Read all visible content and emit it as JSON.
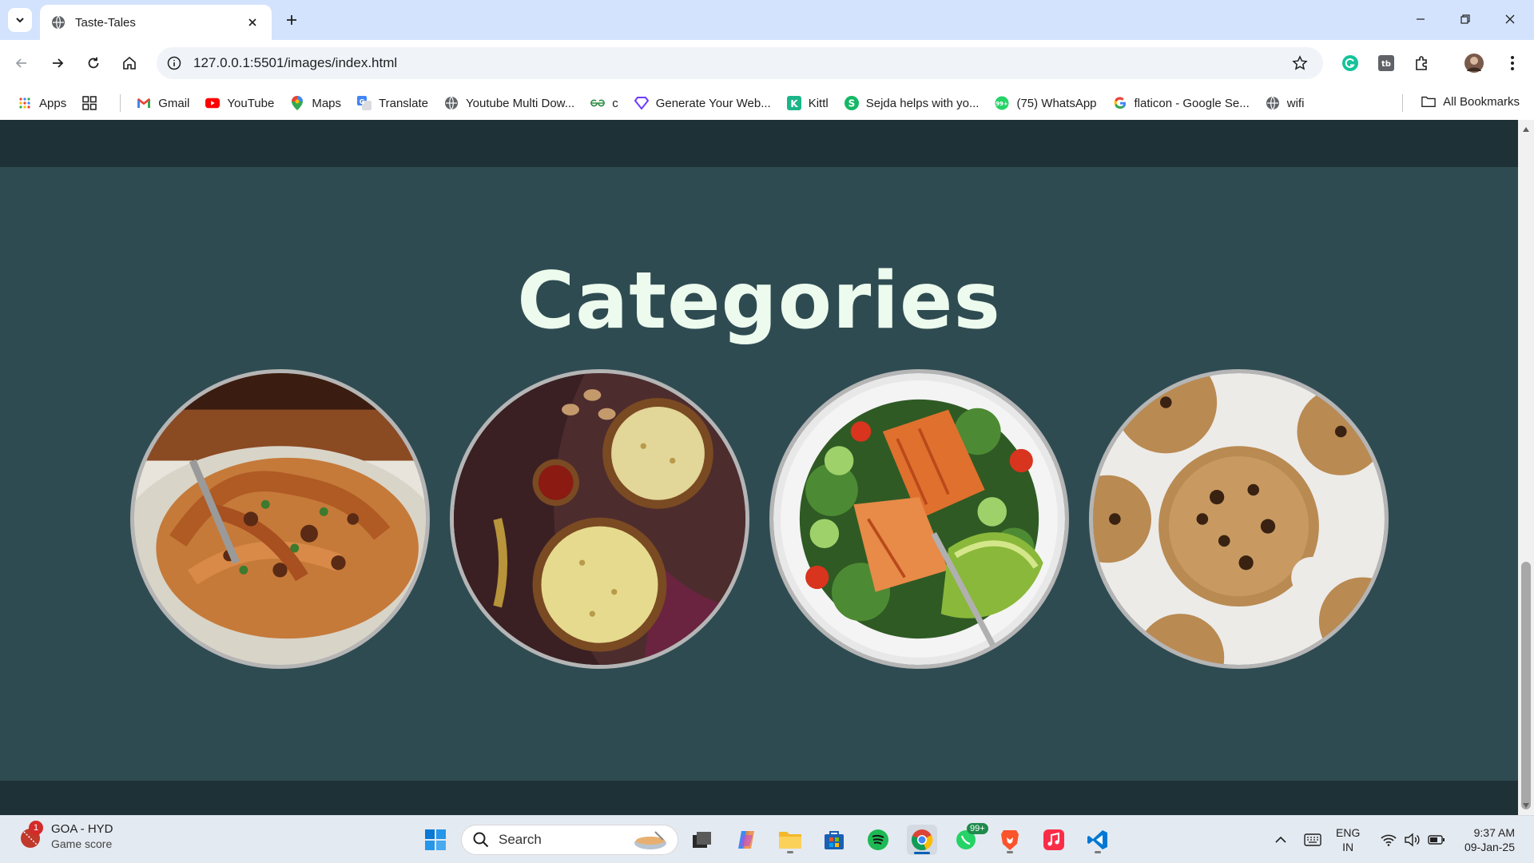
{
  "browser": {
    "tab_title": "Taste-Tales",
    "url": "127.0.0.1:5501/images/index.html"
  },
  "bookmarks": [
    {
      "label": "Apps",
      "icon": "apps-grid-icon",
      "color": "#4285f4"
    },
    {
      "label": "Gmail",
      "icon": "gmail-icon",
      "color": "#ea4335"
    },
    {
      "label": "YouTube",
      "icon": "youtube-icon",
      "color": "#ff0000"
    },
    {
      "label": "Maps",
      "icon": "maps-pin-icon",
      "color": "#34a853"
    },
    {
      "label": "Translate",
      "icon": "translate-icon",
      "color": "#4285f4"
    },
    {
      "label": "Youtube Multi Dow...",
      "icon": "globe-icon",
      "color": "#5f6368"
    },
    {
      "label": "c",
      "icon": "geeks-icon",
      "color": "#2f8d46"
    },
    {
      "label": "Generate Your Web...",
      "icon": "diamond-icon",
      "color": "#6c3cff"
    },
    {
      "label": "Kittl",
      "icon": "kittl-icon",
      "color": "#1bb58a"
    },
    {
      "label": "Sejda helps with yo...",
      "icon": "sejda-icon",
      "color": "#14b866"
    },
    {
      "label": "(75) WhatsApp",
      "icon": "whatsapp-icon",
      "color": "#25d366"
    },
    {
      "label": "flaticon - Google Se...",
      "icon": "google-icon",
      "color": "#4285f4"
    },
    {
      "label": "wifi",
      "icon": "globe-icon",
      "color": "#5f6368"
    }
  ],
  "all_bookmarks_label": "All Bookmarks",
  "page": {
    "heading": "Categories",
    "categories": [
      {
        "icon": "pasta-image"
      },
      {
        "icon": "kheer-image"
      },
      {
        "icon": "salmon-salad-image"
      },
      {
        "icon": "cookies-image"
      }
    ]
  },
  "taskbar": {
    "widget_title": "GOA - HYD",
    "widget_sub": "Game score",
    "widget_badge": "1",
    "search_label": "Search",
    "whatsapp_badge": "99+",
    "lang_top": "ENG",
    "lang_bottom": "IN",
    "time": "9:37 AM",
    "date": "09-Jan-25"
  }
}
